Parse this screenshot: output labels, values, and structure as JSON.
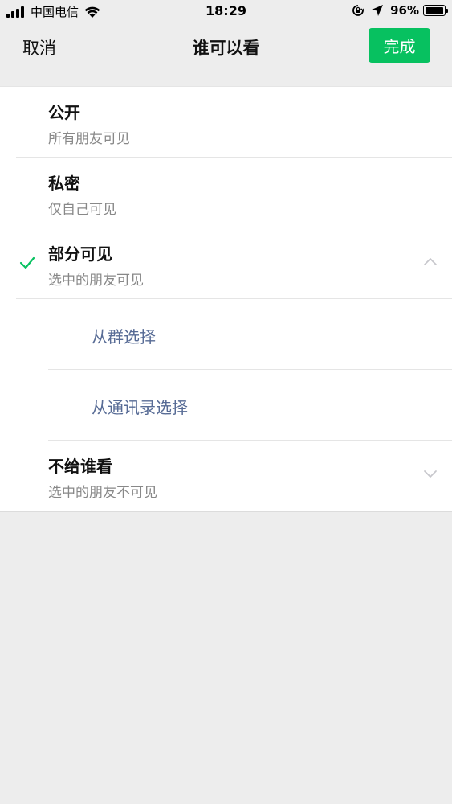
{
  "status_bar": {
    "carrier": "中国电信",
    "time": "18:29",
    "battery_percent": "96%",
    "icons": [
      "signal-icon",
      "wifi-icon",
      "orientation-lock-icon",
      "location-arrow-icon",
      "battery-icon"
    ]
  },
  "nav": {
    "cancel_label": "取消",
    "title": "谁可以看",
    "done_label": "完成",
    "accent_color": "#07c160"
  },
  "options": [
    {
      "title": "公开",
      "desc": "所有朋友可见",
      "selected": false
    },
    {
      "title": "私密",
      "desc": "仅自己可见",
      "selected": false
    },
    {
      "title": "部分可见",
      "desc": "选中的朋友可见",
      "selected": true,
      "expanded": true,
      "sub_options": [
        {
          "label": "从群选择"
        },
        {
          "label": "从通讯录选择"
        }
      ]
    },
    {
      "title": "不给谁看",
      "desc": "选中的朋友不可见",
      "selected": false,
      "expanded": false
    }
  ],
  "colors": {
    "link_blue": "#576b95",
    "check_green": "#07c160",
    "page_bg": "#ededed"
  }
}
